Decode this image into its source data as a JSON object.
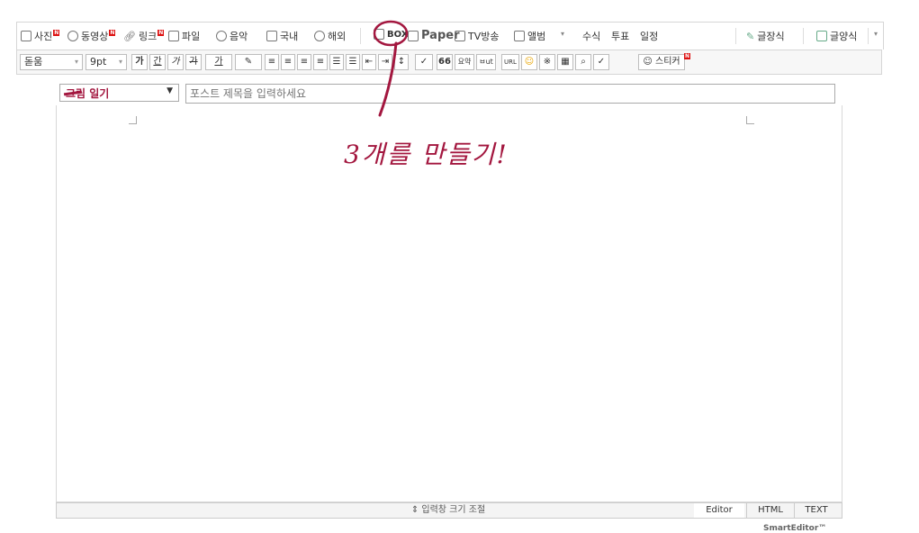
{
  "toolbar1": {
    "photo": "사진",
    "video": "동영상",
    "link": "링크",
    "file": "파일",
    "music": "음악",
    "domestic": "국내",
    "overseas": "해외",
    "box": "BOX",
    "paper": "Paper",
    "tv": "TV방송",
    "album": "앨범",
    "formula": "수식",
    "vote": "투표",
    "schedule": "일정",
    "quote_style": "글장식",
    "template": "글양식"
  },
  "toolbar2": {
    "font": "돋움",
    "size": "9pt",
    "bold": "가",
    "underline": "간",
    "italic": "가",
    "strike": "가",
    "fontcolor": "가",
    "quote": "66",
    "summary": "요약",
    "smallcaps": "ㅂut",
    "url": "URL",
    "sticker": "스티커"
  },
  "category": {
    "value": "그림 일기"
  },
  "title_input": {
    "placeholder": "포스트 제목을 입력하세요"
  },
  "annotation": {
    "text": "3개를 만들기!"
  },
  "bottom": {
    "resize": "⇕ 입력창 크기 조절",
    "tab_editor": "Editor",
    "tab_html": "HTML",
    "tab_text": "TEXT",
    "brand": "SmartEditor™"
  },
  "colors": {
    "annotation": "#a3173f",
    "new_badge": "#d11111"
  }
}
